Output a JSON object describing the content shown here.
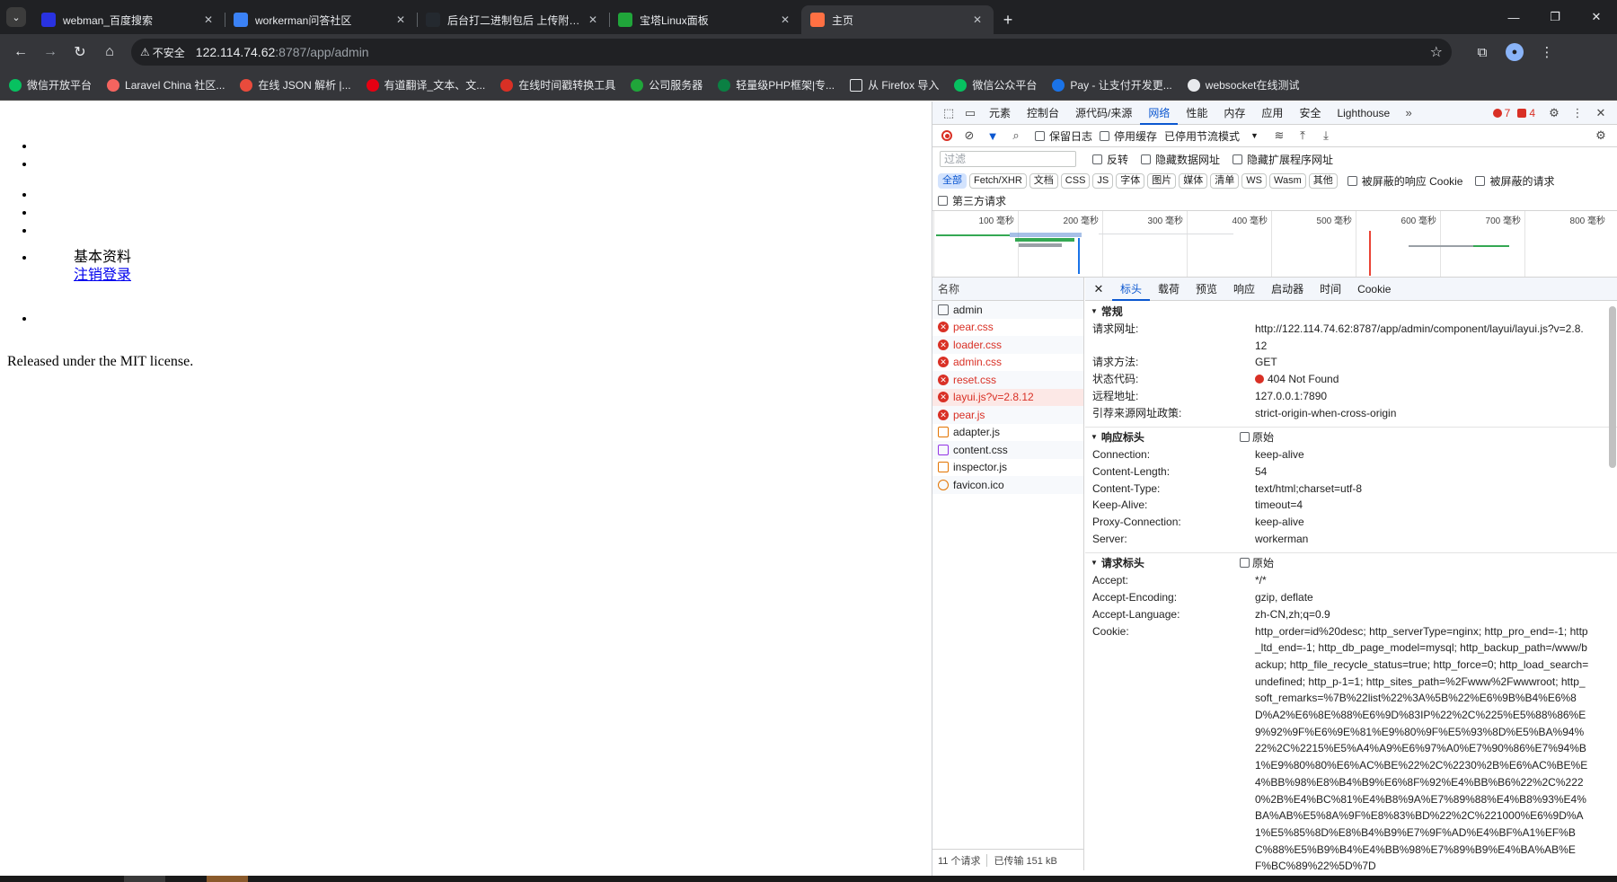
{
  "browser": {
    "tabs": [
      {
        "title": "webman_百度搜索",
        "color": "#2932e1"
      },
      {
        "title": "workerman问答社区",
        "color": "#3b82f6"
      },
      {
        "title": "后台打二进制包后 上传附件报错",
        "color": "#24292f"
      },
      {
        "title": "宝塔Linux面板",
        "color": "#20a53a"
      },
      {
        "title": "主页",
        "color": "#ff7043"
      }
    ],
    "active_tab_index": 4,
    "omnibox": {
      "security_label": "不安全",
      "url_host": "122.114.74.62",
      "url_path": ":8787/app/admin"
    },
    "bookmarks": [
      {
        "label": "微信开放平台",
        "color": "#07c160"
      },
      {
        "label": "Laravel China 社区...",
        "color": "#f4645f"
      },
      {
        "label": "在线 JSON 解析 |...",
        "color": "#e94b3c"
      },
      {
        "label": "有道翻译_文本、文...",
        "color": "#e60012"
      },
      {
        "label": "在线时间戳转换工具",
        "color": "#d93025"
      },
      {
        "label": "公司服务器",
        "color": "#20a53a"
      },
      {
        "label": "轻量级PHP框架|专...",
        "color": "#0b8043"
      },
      {
        "label": "从 Firefox 导入",
        "color": "#e8eaed"
      },
      {
        "label": "微信公众平台",
        "color": "#07c160"
      },
      {
        "label": "Pay - 让支付开发更...",
        "color": "#1a73e8"
      },
      {
        "label": "websocket在线测试",
        "color": "#e8eaed"
      }
    ]
  },
  "page": {
    "profile_label": "基本资料",
    "logout_link": "注销登录",
    "footer": "Released under the MIT license."
  },
  "devtools": {
    "tabs": [
      "元素",
      "控制台",
      "源代码/来源",
      "网络",
      "性能",
      "内存",
      "应用",
      "安全",
      "Lighthouse"
    ],
    "selected_tab": "网络",
    "error_count": "7",
    "warning_count": "4",
    "controls": {
      "preserve_log": "保留日志",
      "disable_cache": "停用缓存",
      "throttling": "已停用节流模式"
    },
    "filter": {
      "placeholder": "过滤",
      "invert": "反转",
      "hide_data_urls": "隐藏数据网址",
      "hide_extension_urls": "隐藏扩展程序网址"
    },
    "type_chips": [
      "全部",
      "Fetch/XHR",
      "文档",
      "CSS",
      "JS",
      "字体",
      "图片",
      "媒体",
      "清单",
      "WS",
      "Wasm",
      "其他"
    ],
    "blocked_cookies": "被屏蔽的响应 Cookie",
    "blocked_requests": "被屏蔽的请求",
    "third_party": "第三方请求",
    "timeline_ticks": [
      "100 毫秒",
      "200 毫秒",
      "300 毫秒",
      "400 毫秒",
      "500 毫秒",
      "600 毫秒",
      "700 毫秒",
      "800 毫秒"
    ],
    "name_column": "名称",
    "requests": [
      {
        "name": "admin",
        "type": "doc",
        "failed": false
      },
      {
        "name": "pear.css",
        "type": "err",
        "failed": true
      },
      {
        "name": "loader.css",
        "type": "err",
        "failed": true
      },
      {
        "name": "admin.css",
        "type": "err",
        "failed": true
      },
      {
        "name": "reset.css",
        "type": "err",
        "failed": true
      },
      {
        "name": "layui.js?v=2.8.12",
        "type": "err",
        "failed": true
      },
      {
        "name": "pear.js",
        "type": "err",
        "failed": true
      },
      {
        "name": "adapter.js",
        "type": "js",
        "failed": false
      },
      {
        "name": "content.css",
        "type": "css",
        "failed": false
      },
      {
        "name": "inspector.js",
        "type": "js",
        "failed": false
      },
      {
        "name": "favicon.ico",
        "type": "fav",
        "failed": false
      }
    ],
    "selected_request_index": 5,
    "status_bar": {
      "requests": "11 个请求",
      "transferred": "已传输 151 kB"
    },
    "detail_tabs": [
      "标头",
      "载荷",
      "预览",
      "响应",
      "启动器",
      "时间",
      "Cookie"
    ],
    "selected_detail_tab": "标头",
    "general": {
      "title": "常规",
      "rows": [
        {
          "k": "请求网址:",
          "v": "http://122.114.74.62:8787/app/admin/component/layui/layui.js?v=2.8.12"
        },
        {
          "k": "请求方法:",
          "v": "GET"
        },
        {
          "k": "状态代码:",
          "v": "404 Not Found"
        },
        {
          "k": "远程地址:",
          "v": "127.0.0.1:7890"
        },
        {
          "k": "引荐来源网址政策:",
          "v": "strict-origin-when-cross-origin"
        }
      ]
    },
    "response_headers": {
      "title": "响应标头",
      "raw": "原始",
      "rows": [
        {
          "k": "Connection:",
          "v": "keep-alive"
        },
        {
          "k": "Content-Length:",
          "v": "54"
        },
        {
          "k": "Content-Type:",
          "v": "text/html;charset=utf-8"
        },
        {
          "k": "Keep-Alive:",
          "v": "timeout=4"
        },
        {
          "k": "Proxy-Connection:",
          "v": "keep-alive"
        },
        {
          "k": "Server:",
          "v": "workerman"
        }
      ]
    },
    "request_headers": {
      "title": "请求标头",
      "raw": "原始",
      "rows": [
        {
          "k": "Accept:",
          "v": "*/*"
        },
        {
          "k": "Accept-Encoding:",
          "v": "gzip, deflate"
        },
        {
          "k": "Accept-Language:",
          "v": "zh-CN,zh;q=0.9"
        },
        {
          "k": "Cookie:",
          "v": "http_order=id%20desc; http_serverType=nginx; http_pro_end=-1; http_ltd_end=-1; http_db_page_model=mysql; http_backup_path=/www/backup; http_file_recycle_status=true; http_force=0; http_load_search=undefined; http_p-1=1; http_sites_path=%2Fwww%2Fwwwroot; http_soft_remarks=%7B%22list%22%3A%5B%22%E6%9B%B4%E6%8D%A2%E6%8E%88%E6%9D%83IP%22%2C%225%E5%88%86%E9%92%9F%E6%9E%81%E9%80%9F%E5%93%8D%E5%BA%94%22%2C%2215%E5%A4%A9%E6%97%A0%E7%90%86%E7%94%B1%E9%80%80%E6%AC%BE%22%2C%2230%2B%E6%AC%BE%E4%BB%98%E8%B4%B9%E6%8F%92%E4%BB%B6%22%2C%2220%2B%E4%BC%81%E4%B8%9A%E7%89%88%E4%B8%93%E4%BA%AB%E5%8A%9F%E8%83%BD%22%2C%221000%E6%9D%A1%E5%85%8D%E8%B4%B9%E7%9F%AD%E4%BF%A1%EF%BC%88%E5%B9%B4%E4%BB%98%E7%89%B9%E4%BA%AB%EF%BC%89%22%5D%7D"
        }
      ]
    }
  }
}
